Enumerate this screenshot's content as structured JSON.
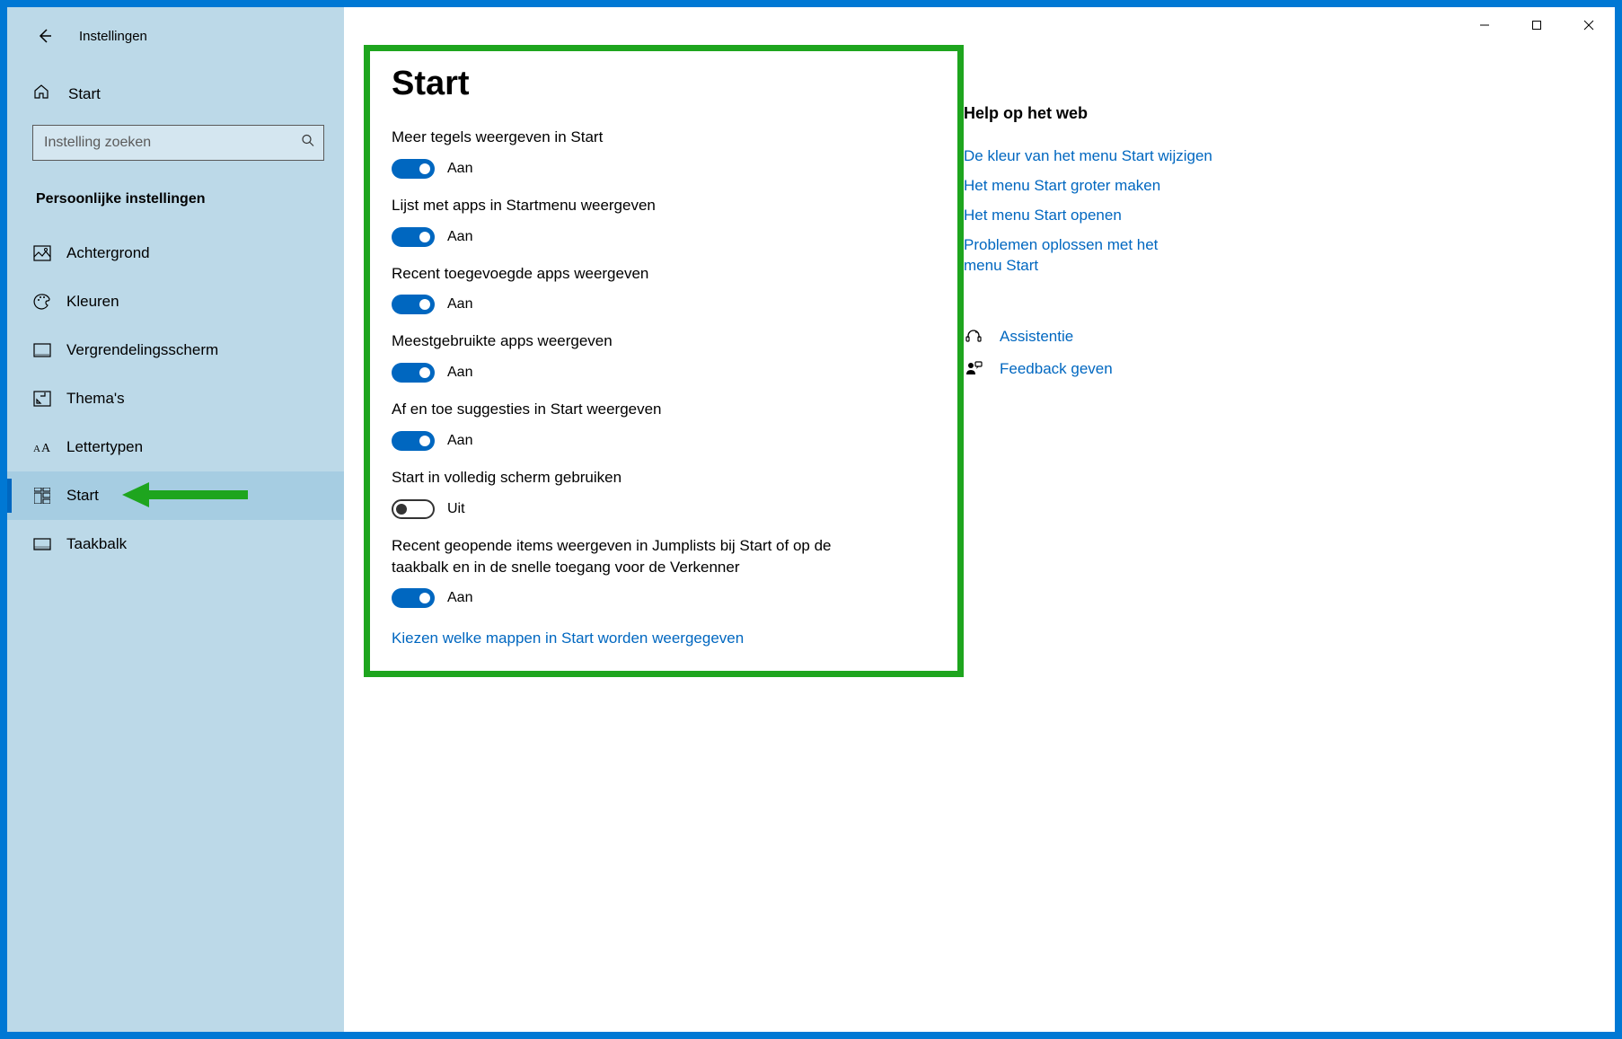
{
  "window": {
    "title": "Instellingen"
  },
  "sidebar": {
    "home_label": "Start",
    "search_placeholder": "Instelling zoeken",
    "category_title": "Persoonlijke instellingen",
    "items": [
      {
        "label": "Achtergrond",
        "active": false
      },
      {
        "label": "Kleuren",
        "active": false
      },
      {
        "label": "Vergrendelingsscherm",
        "active": false
      },
      {
        "label": "Thema's",
        "active": false
      },
      {
        "label": "Lettertypen",
        "active": false
      },
      {
        "label": "Start",
        "active": true
      },
      {
        "label": "Taakbalk",
        "active": false
      }
    ]
  },
  "main": {
    "page_title": "Start",
    "settings": [
      {
        "label": "Meer tegels weergeven in Start",
        "on": true,
        "state": "Aan"
      },
      {
        "label": "Lijst met apps in Startmenu weergeven",
        "on": true,
        "state": "Aan"
      },
      {
        "label": "Recent toegevoegde apps weergeven",
        "on": true,
        "state": "Aan"
      },
      {
        "label": "Meestgebruikte apps weergeven",
        "on": true,
        "state": "Aan"
      },
      {
        "label": "Af en toe suggesties in Start weergeven",
        "on": true,
        "state": "Aan"
      },
      {
        "label": "Start in volledig scherm gebruiken",
        "on": false,
        "state": "Uit"
      },
      {
        "label": "Recent geopende items weergeven in Jumplists bij Start of op de taakbalk en in de snelle toegang voor de Verkenner",
        "on": true,
        "state": "Aan"
      }
    ],
    "folder_link": "Kiezen welke mappen in Start worden weergegeven"
  },
  "help": {
    "title": "Help op het web",
    "links": [
      "De kleur van het menu Start wijzigen",
      "Het menu Start groter maken",
      "Het menu Start openen",
      "Problemen oplossen met het menu Start"
    ],
    "support": {
      "assist": "Assistentie",
      "feedback": "Feedback geven"
    }
  },
  "colors": {
    "accent": "#0067c0",
    "annotation": "#1ea51e"
  }
}
